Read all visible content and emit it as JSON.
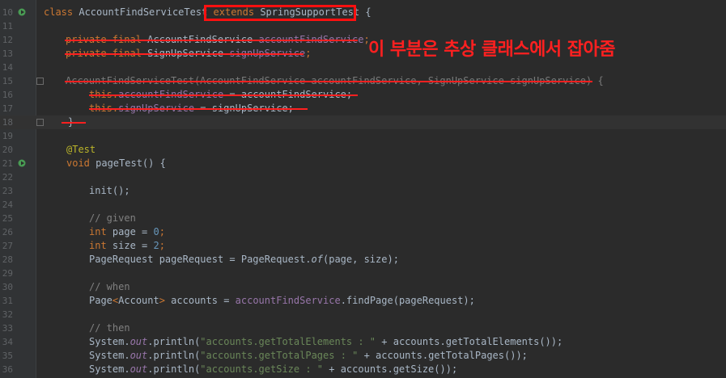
{
  "lines": [
    {
      "num": "10",
      "text": "class AccountFindServiceTest extends SpringSupportTest {"
    },
    {
      "num": "11",
      "text": ""
    },
    {
      "num": "12",
      "text": "private final AccountFindService accountFindService;"
    },
    {
      "num": "13",
      "text": "private final SignUpService signUpService;"
    },
    {
      "num": "14",
      "text": ""
    },
    {
      "num": "15",
      "text": "AccountFindServiceTest(AccountFindService accountFindService, SignUpService signUpService) {"
    },
    {
      "num": "16",
      "text": "this.accountFindService = accountFindService;"
    },
    {
      "num": "17",
      "text": "this.signUpService = signUpService;"
    },
    {
      "num": "18",
      "text": "}"
    },
    {
      "num": "19",
      "text": ""
    },
    {
      "num": "20",
      "text": "@Test"
    },
    {
      "num": "21",
      "text": "void pageTest() {"
    },
    {
      "num": "22",
      "text": ""
    },
    {
      "num": "23",
      "text": "init();"
    },
    {
      "num": "24",
      "text": ""
    },
    {
      "num": "25",
      "text": "// given"
    },
    {
      "num": "26",
      "text": "int page = 0;"
    },
    {
      "num": "27",
      "text": "int size = 2;"
    },
    {
      "num": "28",
      "text": "PageRequest pageRequest = PageRequest.of(page, size);"
    },
    {
      "num": "29",
      "text": ""
    },
    {
      "num": "30",
      "text": "// when"
    },
    {
      "num": "31",
      "text": "Page<Account> accounts = accountFindService.findPage(pageRequest);"
    },
    {
      "num": "32",
      "text": ""
    },
    {
      "num": "33",
      "text": "// then"
    },
    {
      "num": "34",
      "text": "System.out.println(\"accounts.getTotalElements : \" + accounts.getTotalElements());"
    },
    {
      "num": "35",
      "text": "System.out.println(\"accounts.getTotalPages : \" + accounts.getTotalPages());"
    },
    {
      "num": "36",
      "text": "System.out.println(\"accounts.getSize : \" + accounts.getSize());"
    }
  ],
  "tokens": {
    "l10": {
      "a": "class ",
      "b": "AccountFindServiceTest ",
      "c": "extends",
      "d": " SpringSupportTest {"
    },
    "l12": {
      "a": "private final ",
      "b": "AccountFindService ",
      "c": "accountFindService",
      "d": ";"
    },
    "l13": {
      "a": "private final ",
      "b": "SignUpService ",
      "c": "signUpService",
      "d": ";"
    },
    "l15": {
      "a": "AccountFindServiceTest(AccountFindService accountFindService, SignUpService signUpService) {"
    },
    "l16": {
      "a": "this.",
      "b": "accountFindService",
      "c": " = accountFindService;"
    },
    "l17": {
      "a": "this.",
      "b": "signUpService",
      "c": " = signUpService;"
    },
    "l18": {
      "a": "}"
    },
    "l20": {
      "a": "@Test"
    },
    "l21": {
      "a": "void ",
      "b": "pageTest() {"
    },
    "l23": {
      "a": "init();"
    },
    "l25": {
      "a": "// given"
    },
    "l26": {
      "a": "int ",
      "b": "page = ",
      "c": "0",
      "d": ";"
    },
    "l27": {
      "a": "int ",
      "b": "size = ",
      "c": "2",
      "d": ";"
    },
    "l28": {
      "a": "PageRequest pageRequest = PageRequest.",
      "b": "of",
      "c": "(page, size);"
    },
    "l30": {
      "a": "// when"
    },
    "l31": {
      "a": "Page",
      "b": "<",
      "c": "Account",
      "d": ">",
      "e": " accounts = ",
      "f": "accountFindService",
      "g": ".findPage(pageRequest);"
    },
    "l33": {
      "a": "// then"
    },
    "l34": {
      "a": "System.",
      "b": "out",
      "c": ".println(",
      "d": "\"accounts.getTotalElements : \"",
      "e": " + accounts.getTotalElements());"
    },
    "l35": {
      "a": "System.",
      "b": "out",
      "c": ".println(",
      "d": "\"accounts.getTotalPages : \"",
      "e": " + accounts.getTotalPages());"
    },
    "l36": {
      "a": "System.",
      "b": "out",
      "c": ".println(",
      "d": "\"accounts.getSize : \"",
      "e": " + accounts.getSize());"
    }
  },
  "annotation_note": "이 부분은 추상 클래스에서 잡아줌",
  "colors": {
    "annotation": "#ff2020",
    "background": "#2b2b2b",
    "keyword": "#cc7832",
    "string": "#6a8759"
  }
}
